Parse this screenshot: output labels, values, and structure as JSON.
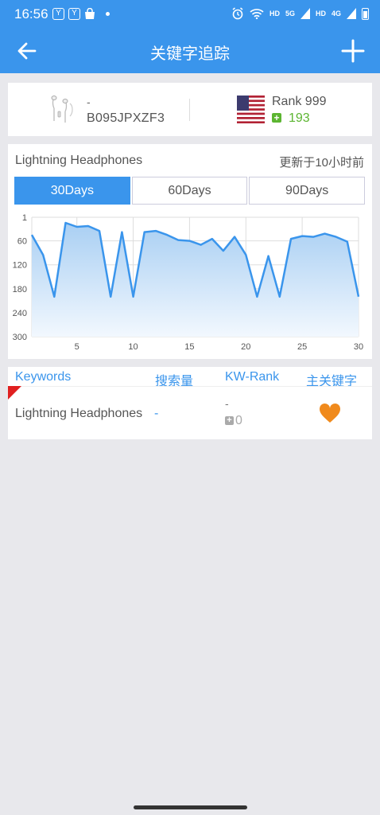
{
  "status_bar": {
    "time": "16:56",
    "notification_icons": [
      "Y",
      "Y"
    ],
    "right_labels": [
      "HD",
      "5G",
      "HD",
      "4G"
    ]
  },
  "app_bar": {
    "title": "关键字追踪",
    "back_icon": "arrow-left-icon",
    "add_icon": "plus-icon"
  },
  "product": {
    "title": "-",
    "asin": "B095JPXZF3",
    "rank_label": "Rank 999",
    "rank_change": "193",
    "marketplace_flag": "us-flag-icon"
  },
  "trend": {
    "keyword": "Lightning Headphones",
    "updated": "更新于10小时前",
    "tabs": [
      {
        "label": "30Days",
        "active": true
      },
      {
        "label": "60Days",
        "active": false
      },
      {
        "label": "90Days",
        "active": false
      }
    ]
  },
  "chart_data": {
    "type": "area",
    "x": [
      1,
      2,
      3,
      4,
      5,
      6,
      7,
      8,
      9,
      10,
      11,
      12,
      13,
      14,
      15,
      16,
      17,
      18,
      19,
      20,
      21,
      22,
      23,
      24,
      25,
      26,
      27,
      28,
      29,
      30
    ],
    "values": [
      45,
      95,
      200,
      15,
      25,
      23,
      35,
      200,
      38,
      200,
      38,
      35,
      45,
      58,
      60,
      70,
      55,
      85,
      50,
      95,
      200,
      98,
      200,
      55,
      48,
      50,
      42,
      50,
      62,
      200
    ],
    "y_ticks": [
      "1",
      "60",
      "120",
      "180",
      "240",
      "300"
    ],
    "x_ticks": [
      "5",
      "10",
      "15",
      "20",
      "25",
      "30"
    ],
    "ylim": [
      1,
      300
    ],
    "y_inverted": true,
    "xlim": [
      1,
      30
    ],
    "grid": true,
    "color": "#3a95ec",
    "fill_top": "#a9cff3",
    "fill_bottom": "#f2f8fe"
  },
  "keywords_table": {
    "headers": [
      "Keywords",
      "搜索量",
      "KW-Rank",
      "主关键字"
    ],
    "rows": [
      {
        "keyword": "Lightning Headphones",
        "volume": "-",
        "kw_rank": "-",
        "rank_change": "0",
        "favorite": true
      }
    ]
  },
  "colors": {
    "primary": "#3a95ec",
    "positive": "#5cb531",
    "favorite": "#f08a1c",
    "corner_flag": "#e02020"
  }
}
